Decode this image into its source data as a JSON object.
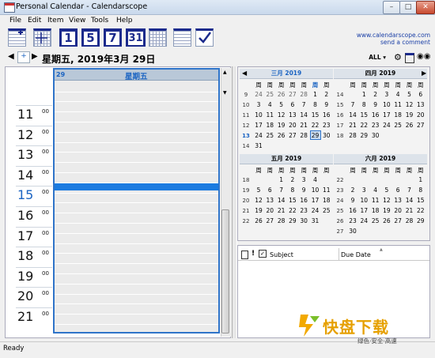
{
  "window": {
    "title": "Personal Calendar - Calendarscope"
  },
  "menu": [
    "File",
    "Edit",
    "Item",
    "View",
    "Tools",
    "Help"
  ],
  "toolbar": {
    "day_buttons": [
      "1",
      "5",
      "7",
      "31"
    ]
  },
  "links": {
    "site": "www.calendarscope.com",
    "comment": "send a comment"
  },
  "nav": {
    "date": "星期五, 2019年3月 29日",
    "filter": "ALL"
  },
  "day_view": {
    "day_num": "29",
    "day_name": "星期五",
    "hours": [
      "11",
      "12",
      "13",
      "14",
      "15",
      "16",
      "17",
      "18",
      "19",
      "20",
      "21"
    ],
    "minutes": "00",
    "current_hour": "15"
  },
  "mini_calendars": {
    "weekday_headers": [
      "周",
      "周",
      "周",
      "周",
      "周",
      "周",
      "周"
    ],
    "months": [
      {
        "name": "三月 2019",
        "current": true,
        "weeks": [
          {
            "wk": "9",
            "days": [
              "24",
              "25",
              "26",
              "27",
              "28",
              "1",
              "2"
            ]
          },
          {
            "wk": "10",
            "days": [
              "3",
              "4",
              "5",
              "6",
              "7",
              "8",
              "9"
            ]
          },
          {
            "wk": "11",
            "days": [
              "10",
              "11",
              "12",
              "13",
              "14",
              "15",
              "16"
            ]
          },
          {
            "wk": "12",
            "days": [
              "17",
              "18",
              "19",
              "20",
              "21",
              "22",
              "23"
            ]
          },
          {
            "wk": "13",
            "days": [
              "24",
              "25",
              "26",
              "27",
              "28",
              "29",
              "30"
            ]
          },
          {
            "wk": "14",
            "days": [
              "31",
              "",
              "",
              "",
              "",
              "",
              ""
            ]
          }
        ]
      },
      {
        "name": "四月 2019",
        "current": false,
        "weeks": [
          {
            "wk": "14",
            "days": [
              "",
              "1",
              "2",
              "3",
              "4",
              "5",
              "6"
            ]
          },
          {
            "wk": "15",
            "days": [
              "7",
              "8",
              "9",
              "10",
              "11",
              "12",
              "13"
            ]
          },
          {
            "wk": "16",
            "days": [
              "14",
              "15",
              "16",
              "17",
              "18",
              "19",
              "20"
            ]
          },
          {
            "wk": "17",
            "days": [
              "21",
              "22",
              "23",
              "24",
              "25",
              "26",
              "27"
            ]
          },
          {
            "wk": "18",
            "days": [
              "28",
              "29",
              "30",
              "",
              "",
              "",
              ""
            ]
          }
        ]
      },
      {
        "name": "五月 2019",
        "current": false,
        "weeks": [
          {
            "wk": "18",
            "days": [
              "",
              "",
              "1",
              "2",
              "3",
              "4"
            ]
          },
          {
            "wk": "19",
            "days": [
              "5",
              "6",
              "7",
              "8",
              "9",
              "10",
              "11"
            ]
          },
          {
            "wk": "20",
            "days": [
              "12",
              "13",
              "14",
              "15",
              "16",
              "17",
              "18"
            ]
          },
          {
            "wk": "21",
            "days": [
              "19",
              "20",
              "21",
              "22",
              "23",
              "24",
              "25"
            ]
          },
          {
            "wk": "22",
            "days": [
              "26",
              "27",
              "28",
              "29",
              "30",
              "31",
              ""
            ]
          }
        ]
      },
      {
        "name": "六月 2019",
        "current": false,
        "weeks": [
          {
            "wk": "22",
            "days": [
              "",
              "",
              "",
              "",
              "",
              "",
              "1"
            ]
          },
          {
            "wk": "23",
            "days": [
              "2",
              "3",
              "4",
              "5",
              "6",
              "7",
              "8"
            ]
          },
          {
            "wk": "24",
            "days": [
              "9",
              "10",
              "11",
              "12",
              "13",
              "14",
              "15"
            ]
          },
          {
            "wk": "25",
            "days": [
              "16",
              "17",
              "18",
              "19",
              "20",
              "21",
              "22"
            ]
          },
          {
            "wk": "26",
            "days": [
              "23",
              "24",
              "25",
              "26",
              "27",
              "28",
              "29"
            ]
          },
          {
            "wk": "27",
            "days": [
              "30",
              "",
              "",
              "",
              "",
              "",
              ""
            ]
          }
        ]
      }
    ]
  },
  "tasks": {
    "columns": [
      "Subject",
      "Due Date"
    ],
    "icons": [
      "note-icon",
      "priority-icon",
      "done-check-icon"
    ]
  },
  "status": {
    "text": "Ready"
  },
  "watermark": {
    "text": "快盘下载",
    "sub": "绿色·安全·高速"
  }
}
